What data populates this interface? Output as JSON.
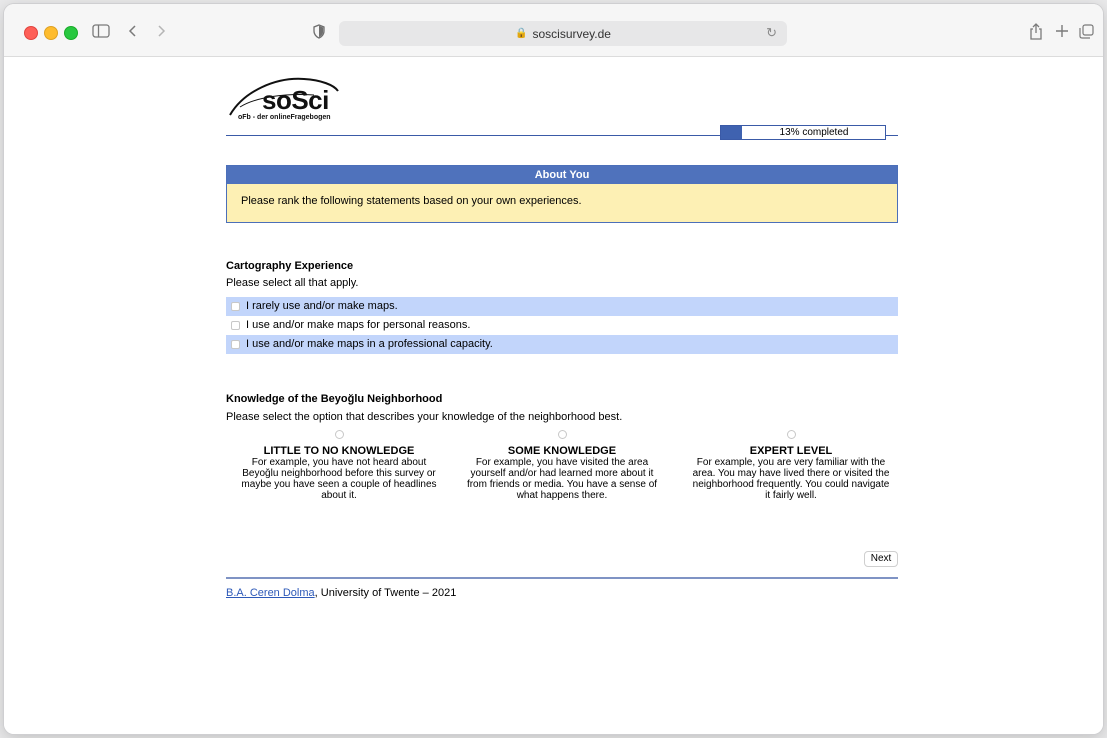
{
  "browser": {
    "url": "soscisurvey.de"
  },
  "logo": {
    "wordmark": "soSci",
    "tagline": "oFb - der onlineFragebogen"
  },
  "progress": {
    "fraction": 0.13,
    "label": "13% completed"
  },
  "intro": {
    "title": "About You",
    "text": "Please rank the following statements based on your own experiences."
  },
  "question1": {
    "title": "Cartography Experience",
    "hint": "Please select all that apply.",
    "options": [
      {
        "label": "I rarely use and/or make maps.",
        "checked": false
      },
      {
        "label": "I use and/or make maps for personal reasons.",
        "checked": false
      },
      {
        "label": "I use and/or make maps in a professional capacity.",
        "checked": false
      }
    ]
  },
  "question2": {
    "title": "Knowledge of the Beyoğlu Neighborhood",
    "hint": "Please select the option that describes your knowledge of the neighborhood best.",
    "options": [
      {
        "title": "LITTLE TO NO KNOWLEDGE",
        "desc": "For example, you have not heard about Beyoğlu neighborhood before this survey or maybe you have seen a couple of headlines about it."
      },
      {
        "title": "SOME KNOWLEDGE",
        "desc": "For example, you have visited the area yourself and/or had learned more about it from friends or media. You have a sense of what happens there."
      },
      {
        "title": "EXPERT LEVEL",
        "desc": "For example, you are very familiar with the area. You may have lived there or visited the neighborhood frequently. You could navigate it fairly well."
      }
    ]
  },
  "next_label": "Next",
  "footer": {
    "author": "B.A. Ceren Dolma",
    "rest": ", University of Twente – 2021"
  },
  "colors": {
    "accent": "#4f72bc",
    "panel_bg": "#fdf0b4",
    "option_shade": "#c2d5fb"
  },
  "icons": [
    "sidebar-icon",
    "back-icon",
    "forward-icon",
    "privacy-shield-icon",
    "lock-icon",
    "reload-icon",
    "share-icon",
    "new-tab-icon",
    "tab-overview-icon"
  ]
}
